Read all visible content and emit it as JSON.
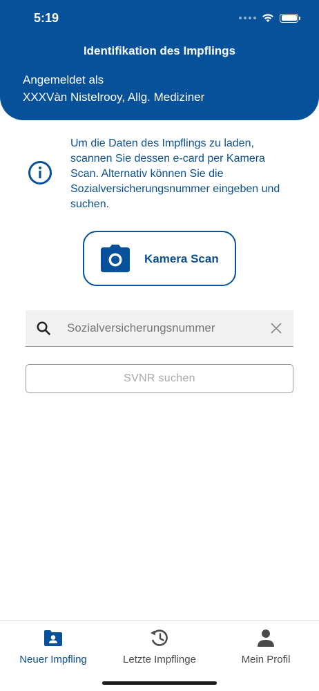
{
  "status_bar": {
    "time": "5:19"
  },
  "header": {
    "title": "Identifikation des Impflings",
    "logged_in_label": "Angemeldet als",
    "logged_in_user": "XXXVàn Nistelrooy, Allg. Mediziner"
  },
  "info": {
    "icon": "info-icon",
    "text": "Um die Daten des Impflings zu laden, scannen Sie dessen e-card per Kamera Scan. Alternativ können Sie die Sozialversicherungsnummer eingeben und suchen."
  },
  "camera_button": {
    "icon": "camera-icon",
    "label": "Kamera Scan"
  },
  "search": {
    "placeholder": "Sozialversicherungsnummer",
    "value": ""
  },
  "svnr_button": {
    "label": "SVNR suchen"
  },
  "tabs": [
    {
      "label": "Neuer Impfling",
      "icon": "contact-card-icon",
      "active": true
    },
    {
      "label": "Letzte Impflinge",
      "icon": "history-icon",
      "active": false
    },
    {
      "label": "Mein Profil",
      "icon": "person-icon",
      "active": false
    }
  ],
  "colors": {
    "brand": "#07519a",
    "text_brand": "#0b4f93",
    "disabled_text": "#a8a8a8"
  }
}
